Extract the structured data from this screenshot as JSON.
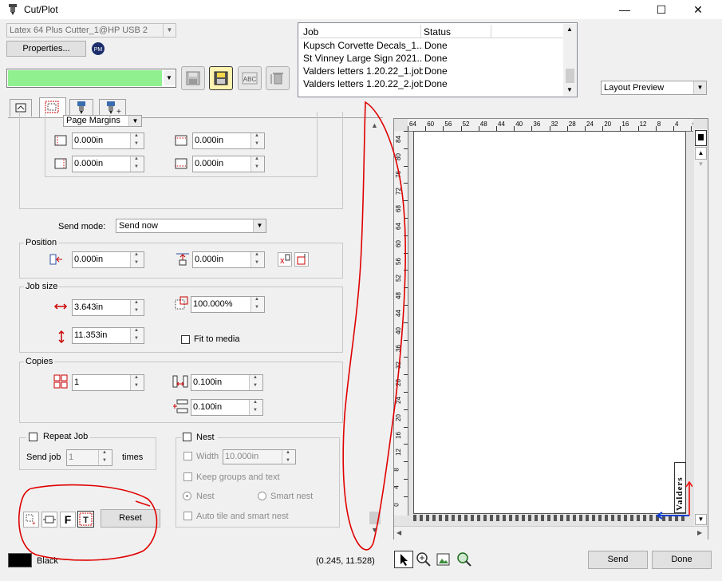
{
  "window": {
    "title": "Cut/Plot",
    "min": "—",
    "max": "☐",
    "close": "✕"
  },
  "device": {
    "selected": "Latex 64 Plus Cutter_1@HP USB 2",
    "properties_label": "Properties..."
  },
  "jobs": {
    "headers": [
      "Job",
      "Status"
    ],
    "rows": [
      {
        "job": "Kupsch Corvette Decals_1...",
        "status": "Done"
      },
      {
        "job": "St Vinney Large Sign 2021...",
        "status": "Done"
      },
      {
        "job": "Valders letters 1.20.22_1.job",
        "status": "Done"
      },
      {
        "job": "Valders letters 1.20.22_2.job",
        "status": "Done"
      }
    ]
  },
  "preview_mode": "Layout Preview",
  "margins": {
    "dropdown": "Page Margins",
    "left": "0.000in",
    "top": "0.000in",
    "right": "0.000in",
    "bottom": "0.000in"
  },
  "send_mode": {
    "label": "Send mode:",
    "value": "Send now"
  },
  "position": {
    "label": "Position",
    "x": "0.000in",
    "y": "0.000in"
  },
  "job_size": {
    "label": "Job size",
    "width": "3.643in",
    "height": "11.353in",
    "scale": "100.000%",
    "fit_label": "Fit to media"
  },
  "copies": {
    "label": "Copies",
    "count": "1",
    "h_spacing": "0.100in",
    "v_spacing": "0.100in"
  },
  "repeat": {
    "label": "Repeat Job",
    "send_job": "Send job",
    "value": "1",
    "times": "times"
  },
  "nest": {
    "label": "Nest",
    "width_label": "Width",
    "width_value": "10.000in",
    "keep_groups": "Keep groups and text",
    "nest_radio": "Nest",
    "smart_nest": "Smart nest",
    "auto_tile": "Auto tile and smart nest"
  },
  "bottom": {
    "f_label": "F",
    "reset": "Reset",
    "color_name": "Black",
    "coords": "(0.245, 11.528)",
    "send": "Send",
    "done": "Done"
  },
  "ruler": {
    "top": [
      "64",
      "60",
      "56",
      "52",
      "48",
      "44",
      "40",
      "36",
      "32",
      "28",
      "24",
      "20",
      "16",
      "12",
      "8",
      "4",
      "0"
    ],
    "left": [
      "84",
      "80",
      "76",
      "72",
      "68",
      "64",
      "60",
      "56",
      "52",
      "48",
      "44",
      "40",
      "36",
      "32",
      "28",
      "24",
      "20",
      "16",
      "12",
      "8",
      "4",
      "0"
    ]
  },
  "preview_item_text": "Valders",
  "colors": {
    "accent_green": "#90f090",
    "annotation_red": "#e00000",
    "color_swatch": "#000000"
  }
}
